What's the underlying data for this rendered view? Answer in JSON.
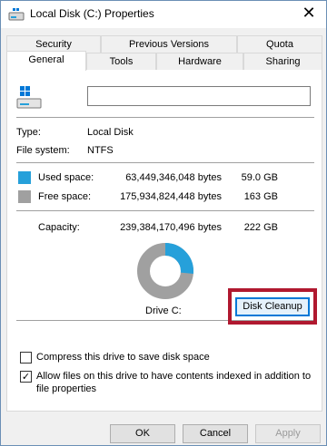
{
  "window": {
    "title": "Local Disk (C:) Properties",
    "close_glyph": "✕"
  },
  "tabs": {
    "top": [
      "Security",
      "Previous Versions",
      "Quota"
    ],
    "bottom": [
      "General",
      "Tools",
      "Hardware",
      "Sharing"
    ],
    "active": "General"
  },
  "general": {
    "name_value": "",
    "type_label": "Type:",
    "type_value": "Local Disk",
    "fs_label": "File system:",
    "fs_value": "NTFS",
    "used": {
      "label": "Used space:",
      "bytes": "63,449,346,048 bytes",
      "size": "59.0 GB",
      "color": "#26a0da"
    },
    "free": {
      "label": "Free space:",
      "bytes": "175,934,824,448 bytes",
      "size": "163 GB",
      "color": "#a0a0a0"
    },
    "capacity": {
      "label": "Capacity:",
      "bytes": "239,384,170,496 bytes",
      "size": "222 GB"
    },
    "used_fraction": 0.265,
    "drive_label": "Drive C:",
    "cleanup_button": "Disk Cleanup",
    "compress_label": "Compress this drive to save disk space",
    "compress_checked": false,
    "index_label": "Allow files on this drive to have contents indexed in addition to file properties",
    "index_line1": "Allow files on this drive to have contents indexed in addition to",
    "index_line2": "file properties",
    "index_checked": true,
    "check_glyph": "✓"
  },
  "footer": {
    "ok": "OK",
    "cancel": "Cancel",
    "apply": "Apply"
  },
  "colors": {
    "highlight": "#b0182f",
    "accent": "#0078d7"
  }
}
